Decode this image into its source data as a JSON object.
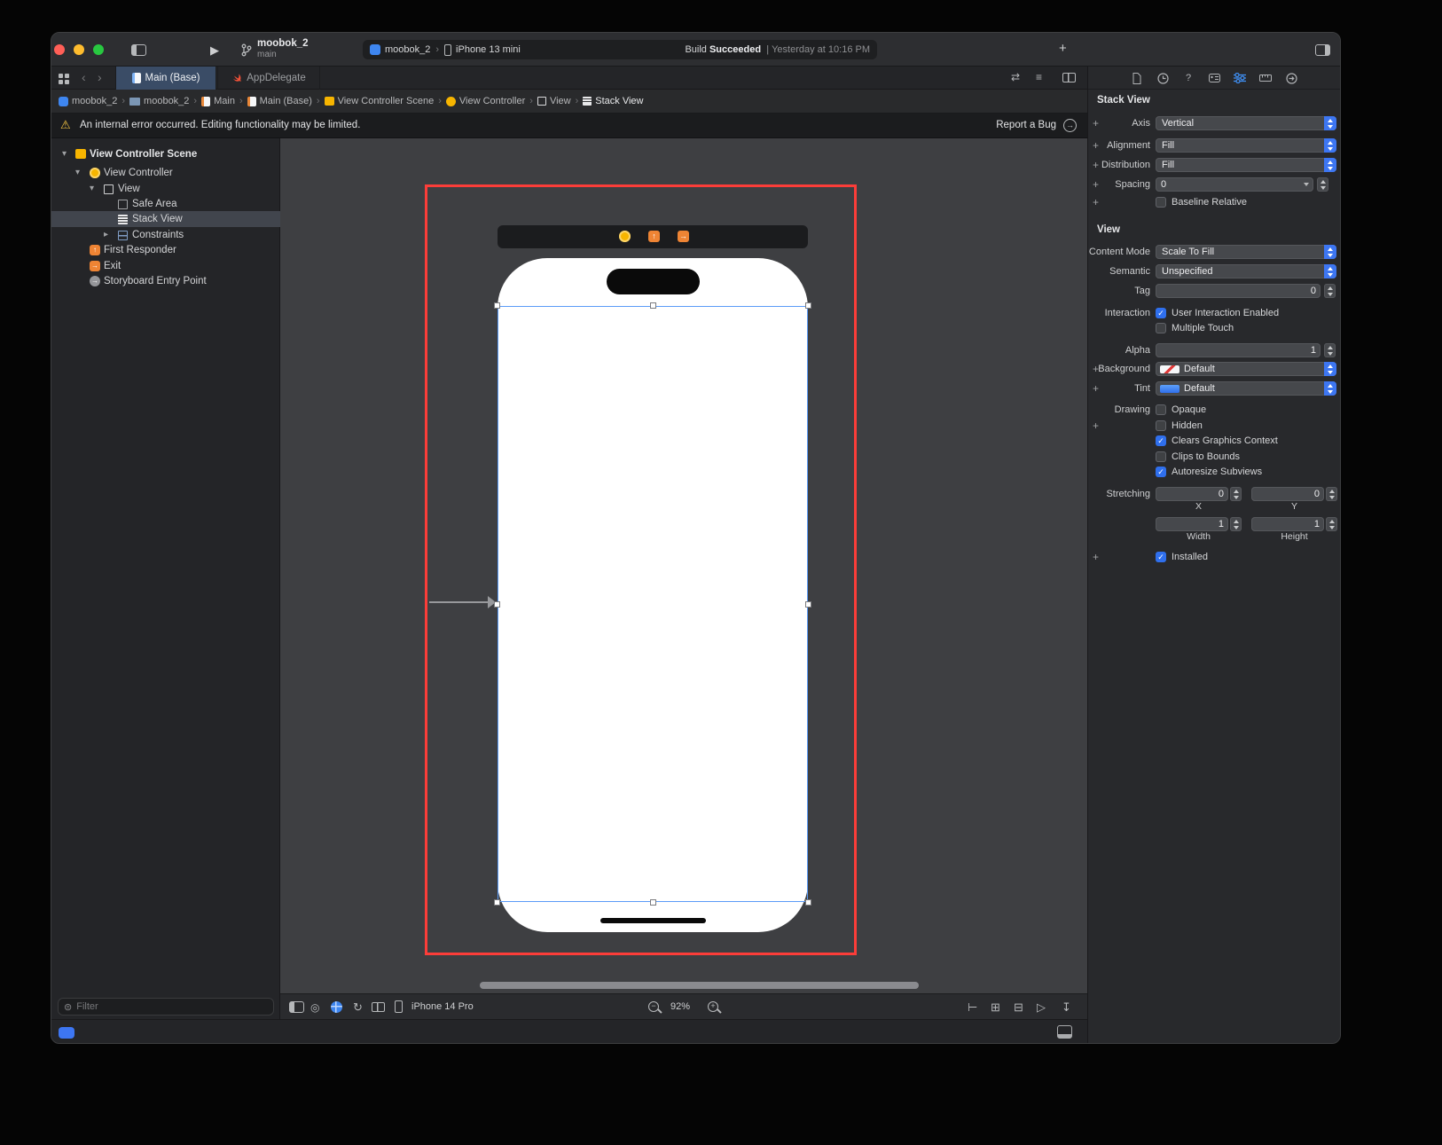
{
  "icons": {
    "play": "▶",
    "plus": "+",
    "chevron_sep": "›",
    "back": "‹",
    "forward": "›",
    "crumb_sep": "›",
    "warning": "⚠",
    "arrow_right": "→",
    "arrow_up": "↑",
    "disclosure_open": "▾",
    "disclosure_closed": "▸",
    "filter": "⊜",
    "rotate": "↻",
    "swap": "⇄",
    "list": "≡",
    "question": "?",
    "minus": "−",
    "zoom_plus": "+",
    "align": "⊢",
    "pin": "⊞",
    "embed": "⊟",
    "resolve": "▷",
    "update": "↧",
    "circle_target": "◎"
  },
  "toolbar": {
    "scheme_name": "moobok_2",
    "scheme_branch": "main",
    "run_destination_project": "moobok_2",
    "run_destination_device": "iPhone 13 mini",
    "build_label": "Build",
    "build_status": "Succeeded",
    "build_separator": "|",
    "build_time": "Yesterday at 10:16 PM"
  },
  "tab_bar": {
    "tabs": [
      {
        "label": "Main (Base)"
      },
      {
        "label": "AppDelegate"
      }
    ]
  },
  "breadcrumbs": {
    "items": [
      {
        "label": "moobok_2"
      },
      {
        "label": "moobok_2"
      },
      {
        "label": "Main"
      },
      {
        "label": "Main (Base)"
      },
      {
        "label": "View Controller Scene"
      },
      {
        "label": "View Controller"
      },
      {
        "label": "View"
      },
      {
        "label": "Stack View"
      }
    ]
  },
  "warning_bar": {
    "message": "An internal error occurred. Editing functionality may be limited.",
    "action": "Report a Bug"
  },
  "outline": {
    "items": [
      {
        "label": "View Controller Scene"
      },
      {
        "label": "View Controller"
      },
      {
        "label": "View"
      },
      {
        "label": "Safe Area"
      },
      {
        "label": "Stack View"
      },
      {
        "label": "Constraints"
      },
      {
        "label": "First Responder"
      },
      {
        "label": "Exit"
      },
      {
        "label": "Storyboard Entry Point"
      }
    ],
    "filter_placeholder": "Filter"
  },
  "canvas": {
    "device_name": "iPhone 14 Pro",
    "zoom_level": "92%"
  },
  "inspector": {
    "stack_view_section": {
      "title": "Stack View",
      "axis": {
        "label": "Axis",
        "value": "Vertical"
      },
      "alignment": {
        "label": "Alignment",
        "value": "Fill"
      },
      "distribution": {
        "label": "Distribution",
        "value": "Fill"
      },
      "spacing": {
        "label": "Spacing",
        "value": "0"
      },
      "baseline_relative": {
        "label": "Baseline Relative",
        "checked": false
      }
    },
    "view_section": {
      "title": "View",
      "content_mode": {
        "label": "Content Mode",
        "value": "Scale To Fill"
      },
      "semantic": {
        "label": "Semantic",
        "value": "Unspecified"
      },
      "tag": {
        "label": "Tag",
        "value": "0"
      },
      "interaction_label": "Interaction",
      "user_interaction": {
        "label": "User Interaction Enabled",
        "checked": true
      },
      "multiple_touch": {
        "label": "Multiple Touch",
        "checked": false
      },
      "alpha": {
        "label": "Alpha",
        "value": "1"
      },
      "background": {
        "label": "Background",
        "value": "Default"
      },
      "tint": {
        "label": "Tint",
        "value": "Default"
      },
      "drawing_label": "Drawing",
      "opaque": {
        "label": "Opaque",
        "checked": false
      },
      "hidden": {
        "label": "Hidden",
        "checked": false
      },
      "clears_graphics_context": {
        "label": "Clears Graphics Context",
        "checked": true
      },
      "clips_to_bounds": {
        "label": "Clips to Bounds",
        "checked": false
      },
      "autoresize_subviews": {
        "label": "Autoresize Subviews",
        "checked": true
      },
      "stretching_label": "Stretching",
      "stretching": {
        "x": "0",
        "y": "0",
        "width": "1",
        "height": "1",
        "x_label": "X",
        "y_label": "Y",
        "width_label": "Width",
        "height_label": "Height"
      },
      "installed": {
        "label": "Installed",
        "checked": true
      }
    }
  }
}
